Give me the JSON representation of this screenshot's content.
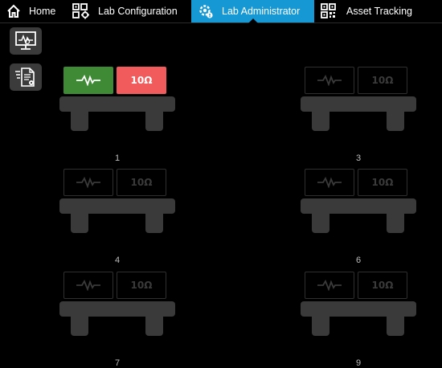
{
  "nav": {
    "tabs": [
      {
        "label": "Home",
        "icon": "home-icon"
      },
      {
        "label": "Lab Configuration",
        "icon": "grid-config-icon"
      },
      {
        "label": "Lab Administrator",
        "icon": "gear-admin-icon",
        "active": true
      },
      {
        "label": "Asset Tracking",
        "icon": "qr-code-icon"
      }
    ],
    "active_color": "#1598d4"
  },
  "sidebar": {
    "items": [
      {
        "icon": "monitor-waveform-icon"
      },
      {
        "icon": "document-list-icon"
      }
    ]
  },
  "stations": [
    {
      "number": "1",
      "active": true,
      "wave_icon": "waveform-icon",
      "ohm_label": "10Ω"
    },
    {
      "number": "3",
      "active": false,
      "wave_icon": "waveform-icon",
      "ohm_label": "10Ω"
    },
    {
      "number": "4",
      "active": false,
      "wave_icon": "waveform-icon",
      "ohm_label": "10Ω"
    },
    {
      "number": "6",
      "active": false,
      "wave_icon": "waveform-icon",
      "ohm_label": "10Ω"
    },
    {
      "number": "7",
      "active": false,
      "wave_icon": "waveform-icon",
      "ohm_label": "10Ω"
    },
    {
      "number": "9",
      "active": false,
      "wave_icon": "waveform-icon",
      "ohm_label": "10Ω"
    }
  ],
  "colors": {
    "active_wave": "#3f8a35",
    "active_ohm": "#f25b5c",
    "inactive_border": "#2f2f2f",
    "bench": "#3a3a3a"
  }
}
